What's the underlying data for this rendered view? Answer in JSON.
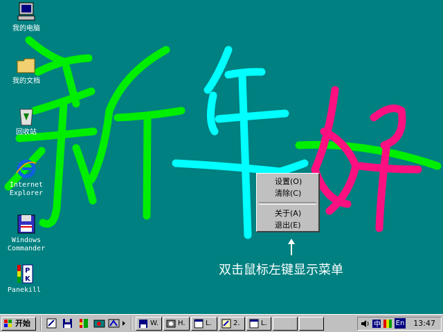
{
  "desktop": {
    "icons": [
      {
        "label": "我的电脑"
      },
      {
        "label": "我的文档"
      },
      {
        "label": "回收站"
      },
      {
        "label": "Internet\nExplorer"
      },
      {
        "label": "Windows\nCommander"
      },
      {
        "label": "Panekill"
      }
    ],
    "context_menu": {
      "items": [
        "设置(O)",
        "清除(C)",
        "关于(A)",
        "退出(E)"
      ]
    },
    "hint": "双击鼠标左键显示菜单",
    "stroke_colors": {
      "green": "#00ee00",
      "cyan": "#00ffff",
      "pink": "#ff1080"
    }
  },
  "taskbar": {
    "start_label": "开始",
    "tasks": [
      "W.",
      "H.",
      "L.",
      "2.",
      "L.",
      "",
      ""
    ],
    "clock": "13:47",
    "tray_lang": "En"
  }
}
